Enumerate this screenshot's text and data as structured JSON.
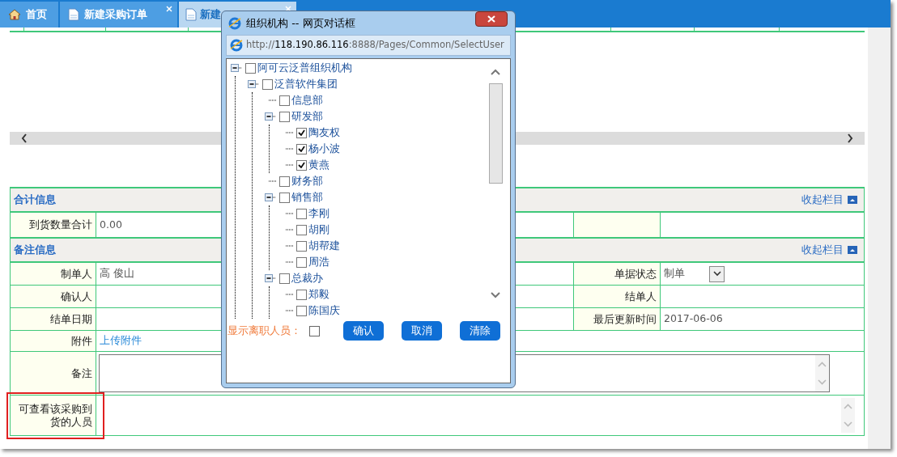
{
  "tabs": [
    {
      "label": "首页",
      "kind": "home",
      "selected": false,
      "closable": false
    },
    {
      "label": "新建采购订单",
      "kind": "document",
      "selected": false,
      "closable": true
    },
    {
      "label": "新建",
      "kind": "document",
      "selected": true,
      "closable": true
    }
  ],
  "form": {
    "sections": [
      {
        "title": "合计信息",
        "collapse_link": "收起栏目",
        "rows": [
          {
            "kind": "pair",
            "label": "到货数量合计",
            "value": "0.00"
          }
        ]
      },
      {
        "title": "备注信息",
        "collapse_link": "收起栏目",
        "rows": [
          {
            "kind": "pair",
            "label": "制单人",
            "value": "高 俊山",
            "label2": "单据状态",
            "select_value": "制单"
          },
          {
            "kind": "pair",
            "label": "确认人",
            "label2": "结单人"
          },
          {
            "kind": "pair",
            "label": "结单日期",
            "label2": "最后更新时间",
            "value2": "2017-06-06"
          },
          {
            "kind": "link",
            "label": "附件",
            "link": "上传附件"
          },
          {
            "kind": "textarea",
            "label": "备注",
            "bordered": true,
            "highlighted": false
          },
          {
            "kind": "textarea",
            "label": "可查看该采购到货的人员",
            "bordered": false,
            "highlighted": true
          }
        ]
      }
    ]
  },
  "dialog": {
    "title": "组织机构 -- 网页对话框",
    "url_prefix": "http://",
    "url_host": "118.190.86.116",
    "url_path": ":8888/Pages/Common/SelectUser",
    "tree": [
      {
        "label": "阿可云泛普组织机构",
        "checked": false,
        "expanded": true,
        "children": [
          {
            "label": "泛普软件集团",
            "checked": false,
            "expanded": true,
            "children": [
              {
                "label": "信息部",
                "checked": false
              },
              {
                "label": "研发部",
                "checked": false,
                "expanded": true,
                "children": [
                  {
                    "label": "陶友权",
                    "checked": true
                  },
                  {
                    "label": "杨小波",
                    "checked": true
                  },
                  {
                    "label": "黄燕",
                    "checked": true
                  }
                ]
              },
              {
                "label": "财务部",
                "checked": false
              },
              {
                "label": "销售部",
                "checked": false,
                "expanded": true,
                "children": [
                  {
                    "label": "李刚",
                    "checked": false
                  },
                  {
                    "label": "胡刚",
                    "checked": false
                  },
                  {
                    "label": "胡帮建",
                    "checked": false
                  },
                  {
                    "label": "周浩",
                    "checked": false
                  }
                ]
              },
              {
                "label": "总裁办",
                "checked": false,
                "expanded": true,
                "children": [
                  {
                    "label": "郑毅",
                    "checked": false
                  },
                  {
                    "label": "陈国庆",
                    "checked": false
                  }
                ]
              }
            ]
          }
        ]
      }
    ],
    "show_resigned": {
      "label": "显示离职人员：",
      "checked": false
    },
    "buttons": [
      "确认",
      "取消",
      "清除"
    ]
  }
}
